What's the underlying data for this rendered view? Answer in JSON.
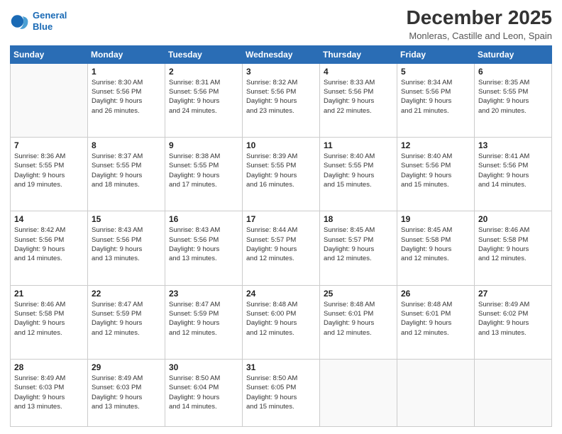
{
  "logo": {
    "line1": "General",
    "line2": "Blue"
  },
  "title": "December 2025",
  "subtitle": "Monleras, Castille and Leon, Spain",
  "days_of_week": [
    "Sunday",
    "Monday",
    "Tuesday",
    "Wednesday",
    "Thursday",
    "Friday",
    "Saturday"
  ],
  "weeks": [
    [
      {
        "num": "",
        "info": ""
      },
      {
        "num": "1",
        "info": "Sunrise: 8:30 AM\nSunset: 5:56 PM\nDaylight: 9 hours\nand 26 minutes."
      },
      {
        "num": "2",
        "info": "Sunrise: 8:31 AM\nSunset: 5:56 PM\nDaylight: 9 hours\nand 24 minutes."
      },
      {
        "num": "3",
        "info": "Sunrise: 8:32 AM\nSunset: 5:56 PM\nDaylight: 9 hours\nand 23 minutes."
      },
      {
        "num": "4",
        "info": "Sunrise: 8:33 AM\nSunset: 5:56 PM\nDaylight: 9 hours\nand 22 minutes."
      },
      {
        "num": "5",
        "info": "Sunrise: 8:34 AM\nSunset: 5:56 PM\nDaylight: 9 hours\nand 21 minutes."
      },
      {
        "num": "6",
        "info": "Sunrise: 8:35 AM\nSunset: 5:55 PM\nDaylight: 9 hours\nand 20 minutes."
      }
    ],
    [
      {
        "num": "7",
        "info": "Sunrise: 8:36 AM\nSunset: 5:55 PM\nDaylight: 9 hours\nand 19 minutes."
      },
      {
        "num": "8",
        "info": "Sunrise: 8:37 AM\nSunset: 5:55 PM\nDaylight: 9 hours\nand 18 minutes."
      },
      {
        "num": "9",
        "info": "Sunrise: 8:38 AM\nSunset: 5:55 PM\nDaylight: 9 hours\nand 17 minutes."
      },
      {
        "num": "10",
        "info": "Sunrise: 8:39 AM\nSunset: 5:55 PM\nDaylight: 9 hours\nand 16 minutes."
      },
      {
        "num": "11",
        "info": "Sunrise: 8:40 AM\nSunset: 5:55 PM\nDaylight: 9 hours\nand 15 minutes."
      },
      {
        "num": "12",
        "info": "Sunrise: 8:40 AM\nSunset: 5:56 PM\nDaylight: 9 hours\nand 15 minutes."
      },
      {
        "num": "13",
        "info": "Sunrise: 8:41 AM\nSunset: 5:56 PM\nDaylight: 9 hours\nand 14 minutes."
      }
    ],
    [
      {
        "num": "14",
        "info": "Sunrise: 8:42 AM\nSunset: 5:56 PM\nDaylight: 9 hours\nand 14 minutes."
      },
      {
        "num": "15",
        "info": "Sunrise: 8:43 AM\nSunset: 5:56 PM\nDaylight: 9 hours\nand 13 minutes."
      },
      {
        "num": "16",
        "info": "Sunrise: 8:43 AM\nSunset: 5:56 PM\nDaylight: 9 hours\nand 13 minutes."
      },
      {
        "num": "17",
        "info": "Sunrise: 8:44 AM\nSunset: 5:57 PM\nDaylight: 9 hours\nand 12 minutes."
      },
      {
        "num": "18",
        "info": "Sunrise: 8:45 AM\nSunset: 5:57 PM\nDaylight: 9 hours\nand 12 minutes."
      },
      {
        "num": "19",
        "info": "Sunrise: 8:45 AM\nSunset: 5:58 PM\nDaylight: 9 hours\nand 12 minutes."
      },
      {
        "num": "20",
        "info": "Sunrise: 8:46 AM\nSunset: 5:58 PM\nDaylight: 9 hours\nand 12 minutes."
      }
    ],
    [
      {
        "num": "21",
        "info": "Sunrise: 8:46 AM\nSunset: 5:58 PM\nDaylight: 9 hours\nand 12 minutes."
      },
      {
        "num": "22",
        "info": "Sunrise: 8:47 AM\nSunset: 5:59 PM\nDaylight: 9 hours\nand 12 minutes."
      },
      {
        "num": "23",
        "info": "Sunrise: 8:47 AM\nSunset: 5:59 PM\nDaylight: 9 hours\nand 12 minutes."
      },
      {
        "num": "24",
        "info": "Sunrise: 8:48 AM\nSunset: 6:00 PM\nDaylight: 9 hours\nand 12 minutes."
      },
      {
        "num": "25",
        "info": "Sunrise: 8:48 AM\nSunset: 6:01 PM\nDaylight: 9 hours\nand 12 minutes."
      },
      {
        "num": "26",
        "info": "Sunrise: 8:48 AM\nSunset: 6:01 PM\nDaylight: 9 hours\nand 12 minutes."
      },
      {
        "num": "27",
        "info": "Sunrise: 8:49 AM\nSunset: 6:02 PM\nDaylight: 9 hours\nand 13 minutes."
      }
    ],
    [
      {
        "num": "28",
        "info": "Sunrise: 8:49 AM\nSunset: 6:03 PM\nDaylight: 9 hours\nand 13 minutes."
      },
      {
        "num": "29",
        "info": "Sunrise: 8:49 AM\nSunset: 6:03 PM\nDaylight: 9 hours\nand 13 minutes."
      },
      {
        "num": "30",
        "info": "Sunrise: 8:50 AM\nSunset: 6:04 PM\nDaylight: 9 hours\nand 14 minutes."
      },
      {
        "num": "31",
        "info": "Sunrise: 8:50 AM\nSunset: 6:05 PM\nDaylight: 9 hours\nand 15 minutes."
      },
      {
        "num": "",
        "info": ""
      },
      {
        "num": "",
        "info": ""
      },
      {
        "num": "",
        "info": ""
      }
    ]
  ]
}
